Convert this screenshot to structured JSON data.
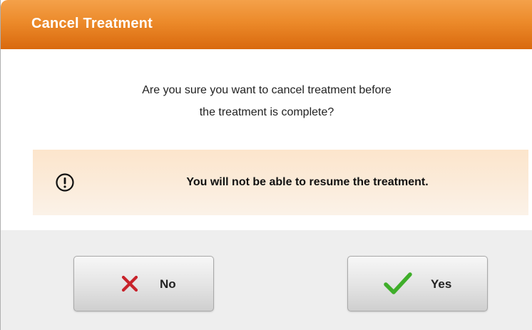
{
  "dialog": {
    "title": "Cancel Treatment",
    "message_line1": "Are you sure you want to cancel treatment before",
    "message_line2": "the treatment is complete?",
    "warning_text": "You will not be able to resume the treatment.",
    "warning_icon": "exclamation-circle-icon"
  },
  "buttons": {
    "no_label": "No",
    "no_icon": "x-icon",
    "yes_label": "Yes",
    "yes_icon": "checkmark-icon"
  },
  "colors": {
    "title_bar": "#ec8a2a",
    "warning_background": "#fbebd9",
    "no_icon": "#c8232b",
    "yes_icon": "#3fae2a"
  }
}
